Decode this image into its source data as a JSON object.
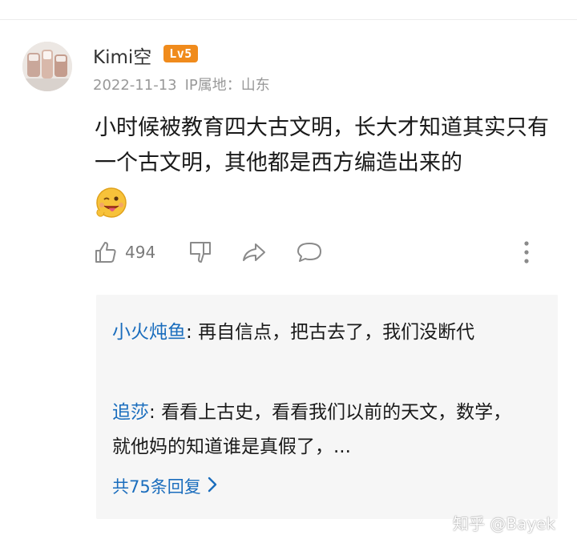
{
  "comment": {
    "username": "Kimi空",
    "level_badge": "Lv5",
    "date": "2022-11-13",
    "ip_location": "IP属地：山东",
    "content": "小时候被教育四大古文明，长大才知道其实只有一个古文明，其他都是西方编造出来的",
    "emoji_icon": "wink-tongue-emoji",
    "like_count": "494"
  },
  "replies": {
    "items": [
      {
        "author": "小火炖鱼",
        "separator": ": ",
        "text": "再自信点，把古去了，我们没断代"
      },
      {
        "author": "追莎",
        "separator": ": ",
        "text": "看看上古史，看看我们以前的天文，数学，就他妈的知道谁是真假了，..."
      }
    ],
    "more_label": "共75条回复"
  },
  "watermark": "知乎 @Bayek",
  "colors": {
    "link": "#1a6dbd",
    "badge": "#f08b1c",
    "muted": "#999999",
    "reply_bg": "#f6f6f6"
  }
}
